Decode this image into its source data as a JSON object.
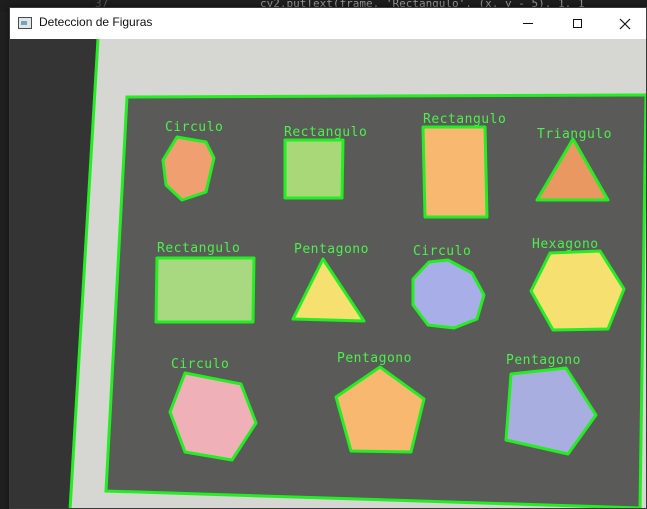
{
  "background_editor": {
    "line_number": "37",
    "code_text": "cv2.putText(frame, 'Rectangulo', (x, y - 5), 1, 1"
  },
  "window": {
    "title": "Deteccion de Figuras",
    "controls": {
      "minimize": "minimize-icon",
      "maximize": "maximize-icon",
      "close": "close-icon"
    }
  },
  "colors": {
    "detection_outline": "#22ee22",
    "label": "#4cf04c",
    "board": "#5a5a58",
    "paper": "#d8d8d4",
    "desk": "#3c3c3c"
  },
  "shapes": [
    {
      "label": "Circulo",
      "kind": "circle",
      "fill": "#f0a070"
    },
    {
      "label": "Rectangulo",
      "kind": "rect",
      "fill": "#a8d878"
    },
    {
      "label": "Rectangulo",
      "kind": "rect",
      "fill": "#f8b870"
    },
    {
      "label": "Triangulo",
      "kind": "triangle",
      "fill": "#e89860"
    },
    {
      "label": "Rectangulo",
      "kind": "rect",
      "fill": "#a8d880"
    },
    {
      "label": "Pentagono",
      "kind": "triangle",
      "fill": "#f5e070"
    },
    {
      "label": "Circulo",
      "kind": "circle",
      "fill": "#a8aee8"
    },
    {
      "label": "Hexagono",
      "kind": "hexagon",
      "fill": "#f5e070"
    },
    {
      "label": "Circulo",
      "kind": "heptagon",
      "fill": "#f0b0b8"
    },
    {
      "label": "Pentagono",
      "kind": "pentagon",
      "fill": "#f8b870"
    },
    {
      "label": "Pentagono",
      "kind": "pentagon",
      "fill": "#a8aee0"
    }
  ]
}
